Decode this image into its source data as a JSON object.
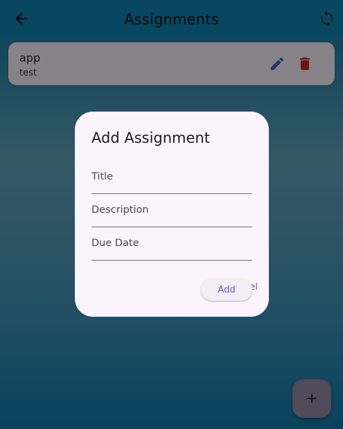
{
  "appbar": {
    "title": "Assignments",
    "back_icon": "arrow-back-icon",
    "refresh_icon": "sync-icon"
  },
  "assignments": [
    {
      "title": "app",
      "subtitle": "test"
    }
  ],
  "dialog": {
    "title": "Add Assignment",
    "fields": [
      {
        "placeholder": "Title",
        "value": ""
      },
      {
        "placeholder": "Description",
        "value": ""
      },
      {
        "placeholder": "Due Date",
        "value": ""
      }
    ],
    "cancel_label": "Cancel",
    "add_label": "Add"
  },
  "fab": {
    "icon": "plus-icon"
  },
  "colors": {
    "appbar": "#0f7aa6",
    "edit_icon": "#2f5fb8",
    "delete_icon": "#b3261e",
    "dialog_bg": "#fcf4fc",
    "accent_text": "#6a55a8"
  }
}
